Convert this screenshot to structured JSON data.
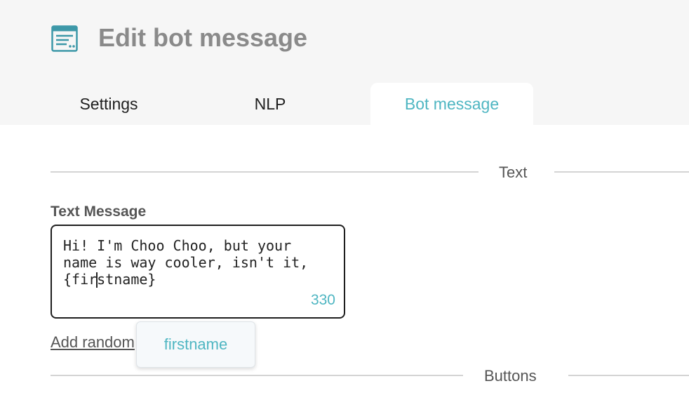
{
  "header": {
    "title": "Edit bot message",
    "icon": "message-panel-icon"
  },
  "tabs": [
    {
      "label": "Settings",
      "active": false
    },
    {
      "label": "NLP",
      "active": false
    },
    {
      "label": "Bot message",
      "active": true
    }
  ],
  "sections": {
    "text": "Text",
    "buttons": "Buttons"
  },
  "text_message": {
    "label": "Text Message",
    "value": "Hi! I'm Choo Choo, but your\nname is way cooler, isn't it,\n{firstname}",
    "char_count": "330"
  },
  "add_random_link": "Add random",
  "suggestion": {
    "items": [
      "firstname"
    ]
  },
  "colors": {
    "accent": "#4fb6c2",
    "header_bg": "#f6f6f6",
    "title_gray": "#8a8a8a"
  }
}
